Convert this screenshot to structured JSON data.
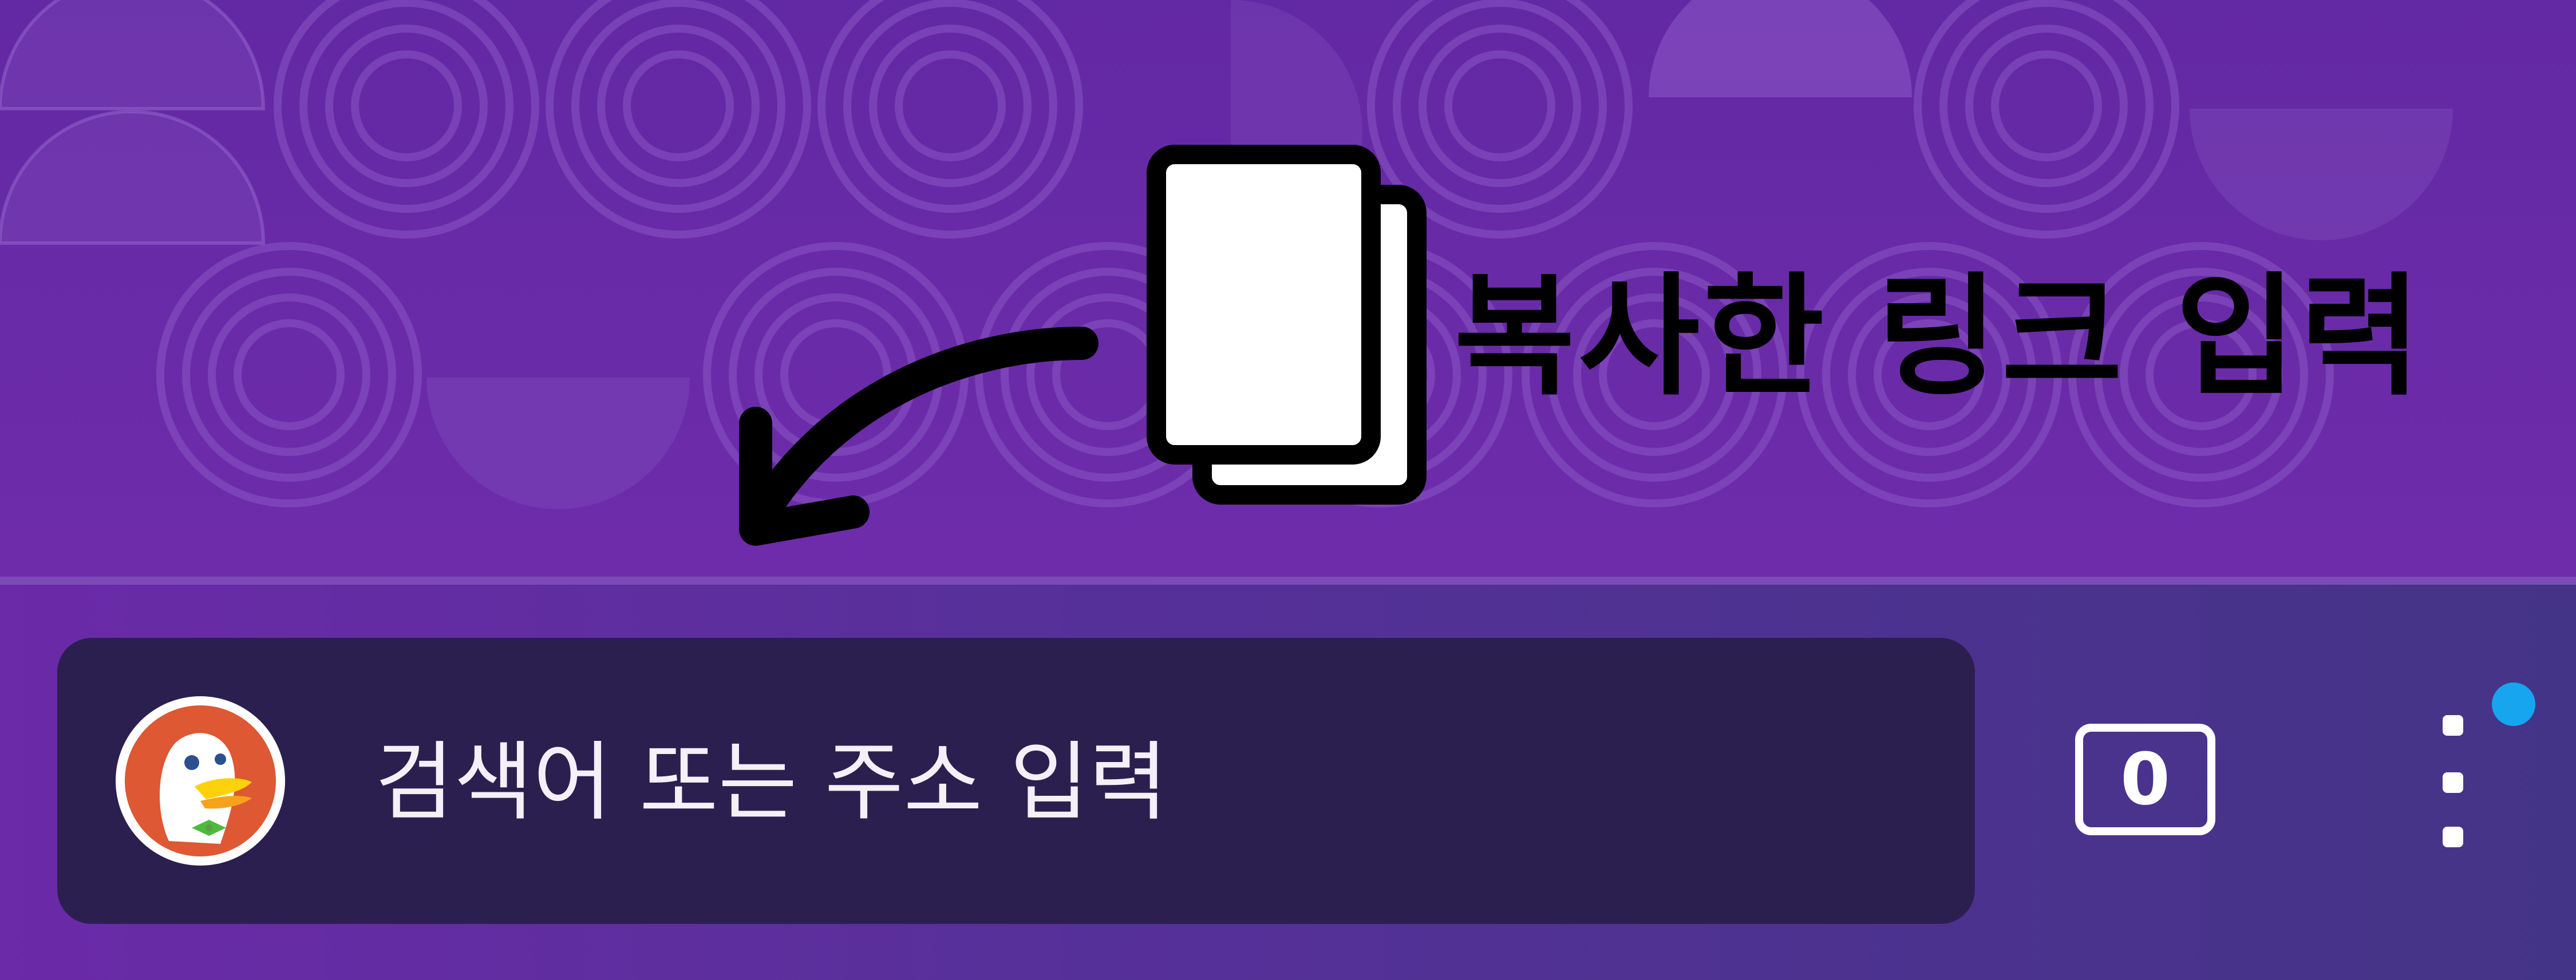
{
  "colors": {
    "pattern_background": "#6328a3",
    "toolbar_gradient_start": "#6b2aa8",
    "toolbar_gradient_end": "#443487",
    "address_bar": "#2b1f50",
    "address_text": "#f3f1f7",
    "notification_dot": "#17a5f0",
    "annotation": "#000000"
  },
  "annotation": {
    "label": "복사한 링크 입력",
    "icon": "copy-icon",
    "arrow": "curved-arrow-icon"
  },
  "toolbar": {
    "search_logo": "duckduckgo-logo",
    "address_placeholder": "검색어 또는 주소 입력",
    "tab_count": "0",
    "menu_icon": "vertical-dots-icon",
    "menu_has_notification": true
  }
}
